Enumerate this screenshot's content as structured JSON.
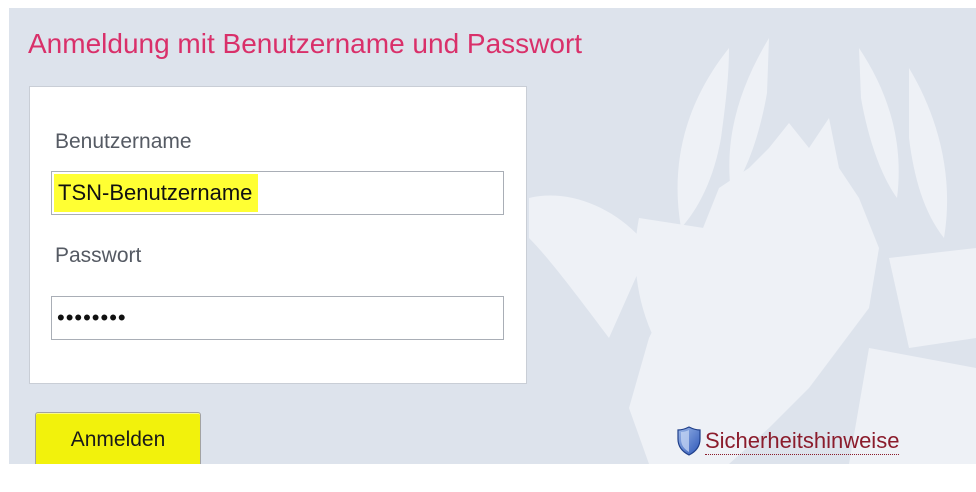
{
  "header": {
    "title": "Anmeldung mit Benutzername und Passwort"
  },
  "form": {
    "username": {
      "label": "Benutzername",
      "value": "TSN-Benutzername"
    },
    "password": {
      "label": "Passwort",
      "masked_value": "••••••••"
    }
  },
  "actions": {
    "login_label": "Anmelden",
    "security_link_label": "Sicherheitshinweise",
    "security_icon": "shield-icon"
  },
  "colors": {
    "title": "#d9306a",
    "background": "#dde3ec",
    "button": "#f2f20c",
    "input_highlight": "#ffff33",
    "link": "#8b1c2c"
  }
}
